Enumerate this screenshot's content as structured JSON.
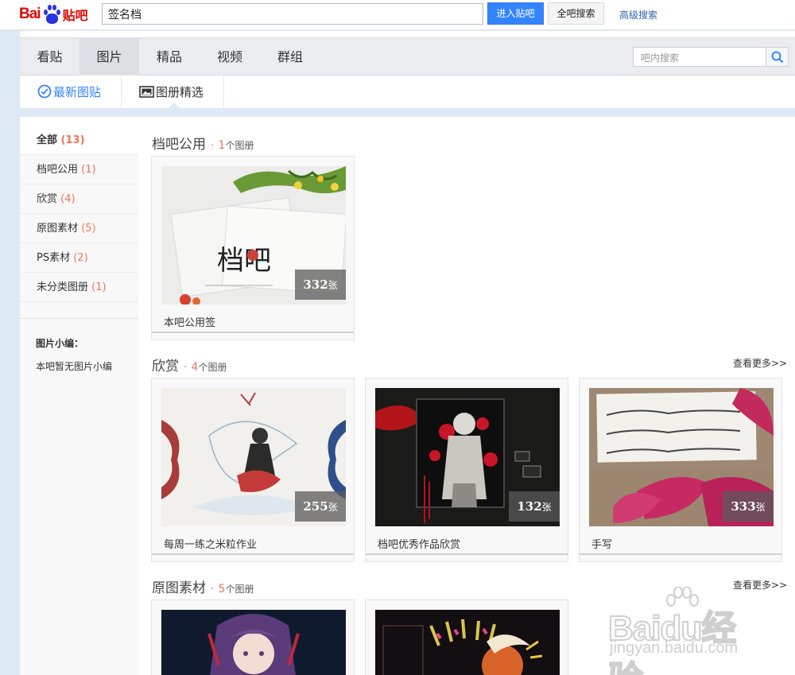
{
  "header": {
    "logo_text": "Bai",
    "logo_tieba": "贴吧",
    "search_value": "签名档",
    "enter_button": "进入贴吧",
    "all_search_button": "全吧搜索",
    "advanced_search": "高级搜索"
  },
  "nav": {
    "tabs": [
      {
        "label": "看贴"
      },
      {
        "label": "图片"
      },
      {
        "label": "精品"
      },
      {
        "label": "视频"
      },
      {
        "label": "群组"
      }
    ],
    "active_tab": "图片",
    "inner_search_placeholder": "吧内搜索"
  },
  "subnav": {
    "latest": "最新图贴",
    "albums": "图册精选"
  },
  "sidebar": {
    "items": [
      {
        "label": "全部",
        "count": "(13)"
      },
      {
        "label": "档吧公用",
        "count": "(1)"
      },
      {
        "label": "欣赏",
        "count": "(4)"
      },
      {
        "label": "原图素材",
        "count": "(5)"
      },
      {
        "label": "PS素材",
        "count": "(2)"
      },
      {
        "label": "未分类图册",
        "count": "(1)"
      }
    ],
    "editor_title": "图片小编：",
    "editor_text": "本吧暂无图片小编"
  },
  "sections": [
    {
      "title": "档吧公用",
      "count": "1",
      "unit": "个图册",
      "albums": [
        {
          "name": "本吧公用签",
          "count": "332",
          "unit": "张"
        }
      ]
    },
    {
      "title": "欣赏",
      "count": "4",
      "unit": "个图册",
      "more": "查看更多>>",
      "albums": [
        {
          "name": "每周一练之米粒作业",
          "count": "255",
          "unit": "张"
        },
        {
          "name": "档吧优秀作品欣赏",
          "count": "132",
          "unit": "张"
        },
        {
          "name": "手写",
          "count": "333",
          "unit": "张"
        }
      ]
    },
    {
      "title": "原图素材",
      "count": "5",
      "unit": "个图册",
      "more": "查看更多>>",
      "albums": [
        {
          "name": ""
        },
        {
          "name": ""
        }
      ]
    }
  ],
  "watermark": {
    "brand": "Baidu经验",
    "url": "jingyan.baidu.com"
  },
  "colors": {
    "accent": "#3385ff",
    "count_orange": "#f1745a",
    "logo_red": "#e10601",
    "logo_blue": "#2932e1"
  }
}
